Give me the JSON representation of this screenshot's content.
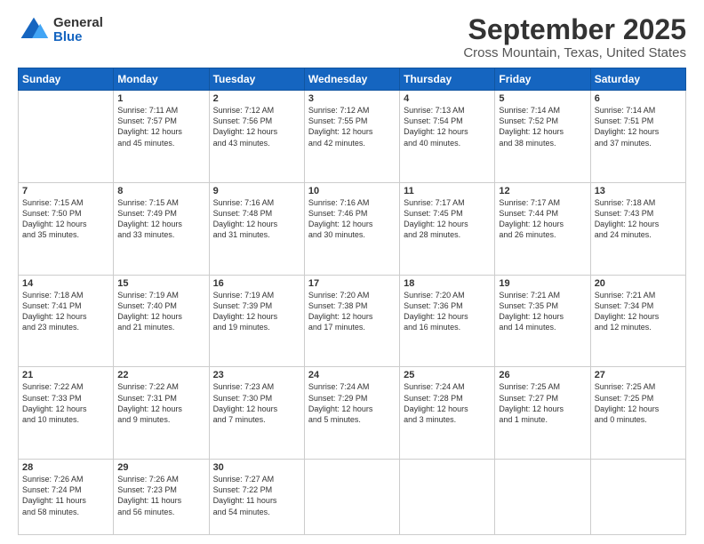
{
  "logo": {
    "general": "General",
    "blue": "Blue"
  },
  "title": "September 2025",
  "subtitle": "Cross Mountain, Texas, United States",
  "days_of_week": [
    "Sunday",
    "Monday",
    "Tuesday",
    "Wednesday",
    "Thursday",
    "Friday",
    "Saturday"
  ],
  "weeks": [
    [
      {
        "day": "",
        "info": ""
      },
      {
        "day": "1",
        "info": "Sunrise: 7:11 AM\nSunset: 7:57 PM\nDaylight: 12 hours\nand 45 minutes."
      },
      {
        "day": "2",
        "info": "Sunrise: 7:12 AM\nSunset: 7:56 PM\nDaylight: 12 hours\nand 43 minutes."
      },
      {
        "day": "3",
        "info": "Sunrise: 7:12 AM\nSunset: 7:55 PM\nDaylight: 12 hours\nand 42 minutes."
      },
      {
        "day": "4",
        "info": "Sunrise: 7:13 AM\nSunset: 7:54 PM\nDaylight: 12 hours\nand 40 minutes."
      },
      {
        "day": "5",
        "info": "Sunrise: 7:14 AM\nSunset: 7:52 PM\nDaylight: 12 hours\nand 38 minutes."
      },
      {
        "day": "6",
        "info": "Sunrise: 7:14 AM\nSunset: 7:51 PM\nDaylight: 12 hours\nand 37 minutes."
      }
    ],
    [
      {
        "day": "7",
        "info": "Sunrise: 7:15 AM\nSunset: 7:50 PM\nDaylight: 12 hours\nand 35 minutes."
      },
      {
        "day": "8",
        "info": "Sunrise: 7:15 AM\nSunset: 7:49 PM\nDaylight: 12 hours\nand 33 minutes."
      },
      {
        "day": "9",
        "info": "Sunrise: 7:16 AM\nSunset: 7:48 PM\nDaylight: 12 hours\nand 31 minutes."
      },
      {
        "day": "10",
        "info": "Sunrise: 7:16 AM\nSunset: 7:46 PM\nDaylight: 12 hours\nand 30 minutes."
      },
      {
        "day": "11",
        "info": "Sunrise: 7:17 AM\nSunset: 7:45 PM\nDaylight: 12 hours\nand 28 minutes."
      },
      {
        "day": "12",
        "info": "Sunrise: 7:17 AM\nSunset: 7:44 PM\nDaylight: 12 hours\nand 26 minutes."
      },
      {
        "day": "13",
        "info": "Sunrise: 7:18 AM\nSunset: 7:43 PM\nDaylight: 12 hours\nand 24 minutes."
      }
    ],
    [
      {
        "day": "14",
        "info": "Sunrise: 7:18 AM\nSunset: 7:41 PM\nDaylight: 12 hours\nand 23 minutes."
      },
      {
        "day": "15",
        "info": "Sunrise: 7:19 AM\nSunset: 7:40 PM\nDaylight: 12 hours\nand 21 minutes."
      },
      {
        "day": "16",
        "info": "Sunrise: 7:19 AM\nSunset: 7:39 PM\nDaylight: 12 hours\nand 19 minutes."
      },
      {
        "day": "17",
        "info": "Sunrise: 7:20 AM\nSunset: 7:38 PM\nDaylight: 12 hours\nand 17 minutes."
      },
      {
        "day": "18",
        "info": "Sunrise: 7:20 AM\nSunset: 7:36 PM\nDaylight: 12 hours\nand 16 minutes."
      },
      {
        "day": "19",
        "info": "Sunrise: 7:21 AM\nSunset: 7:35 PM\nDaylight: 12 hours\nand 14 minutes."
      },
      {
        "day": "20",
        "info": "Sunrise: 7:21 AM\nSunset: 7:34 PM\nDaylight: 12 hours\nand 12 minutes."
      }
    ],
    [
      {
        "day": "21",
        "info": "Sunrise: 7:22 AM\nSunset: 7:33 PM\nDaylight: 12 hours\nand 10 minutes."
      },
      {
        "day": "22",
        "info": "Sunrise: 7:22 AM\nSunset: 7:31 PM\nDaylight: 12 hours\nand 9 minutes."
      },
      {
        "day": "23",
        "info": "Sunrise: 7:23 AM\nSunset: 7:30 PM\nDaylight: 12 hours\nand 7 minutes."
      },
      {
        "day": "24",
        "info": "Sunrise: 7:24 AM\nSunset: 7:29 PM\nDaylight: 12 hours\nand 5 minutes."
      },
      {
        "day": "25",
        "info": "Sunrise: 7:24 AM\nSunset: 7:28 PM\nDaylight: 12 hours\nand 3 minutes."
      },
      {
        "day": "26",
        "info": "Sunrise: 7:25 AM\nSunset: 7:27 PM\nDaylight: 12 hours\nand 1 minute."
      },
      {
        "day": "27",
        "info": "Sunrise: 7:25 AM\nSunset: 7:25 PM\nDaylight: 12 hours\nand 0 minutes."
      }
    ],
    [
      {
        "day": "28",
        "info": "Sunrise: 7:26 AM\nSunset: 7:24 PM\nDaylight: 11 hours\nand 58 minutes."
      },
      {
        "day": "29",
        "info": "Sunrise: 7:26 AM\nSunset: 7:23 PM\nDaylight: 11 hours\nand 56 minutes."
      },
      {
        "day": "30",
        "info": "Sunrise: 7:27 AM\nSunset: 7:22 PM\nDaylight: 11 hours\nand 54 minutes."
      },
      {
        "day": "",
        "info": ""
      },
      {
        "day": "",
        "info": ""
      },
      {
        "day": "",
        "info": ""
      },
      {
        "day": "",
        "info": ""
      }
    ]
  ]
}
